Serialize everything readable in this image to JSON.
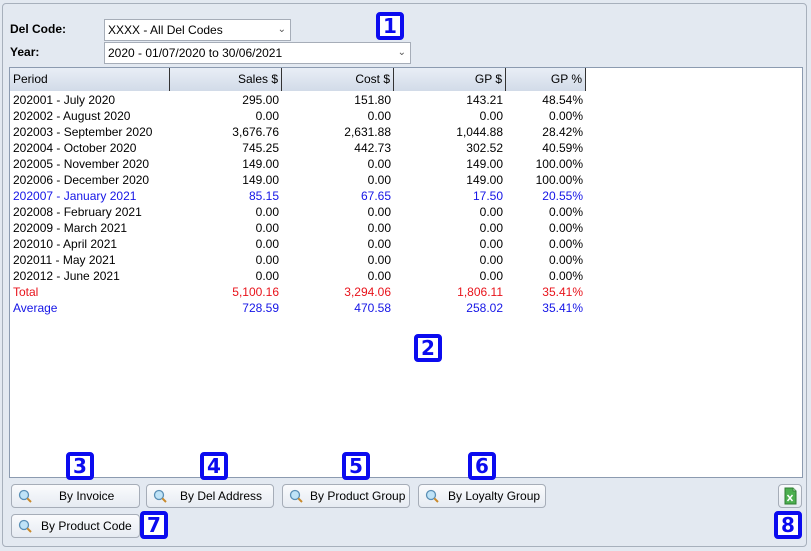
{
  "filters": {
    "del_code_label": "Del Code:",
    "del_code_value": "XXXX - All Del Codes",
    "year_label": "Year:",
    "year_value": "2020 - 01/07/2020 to 30/06/2021"
  },
  "table": {
    "columns": [
      "Period",
      "Sales $",
      "Cost $",
      "GP $",
      "GP %"
    ],
    "rows": [
      {
        "period": "202001 - July 2020",
        "sales": "295.00",
        "cost": "151.80",
        "gp": "143.21",
        "gp_pct": "48.54%",
        "style": "normal"
      },
      {
        "period": "202002 - August 2020",
        "sales": "0.00",
        "cost": "0.00",
        "gp": "0.00",
        "gp_pct": "0.00%",
        "style": "normal"
      },
      {
        "period": "202003 - September 2020",
        "sales": "3,676.76",
        "cost": "2,631.88",
        "gp": "1,044.88",
        "gp_pct": "28.42%",
        "style": "normal"
      },
      {
        "period": "202004 - October 2020",
        "sales": "745.25",
        "cost": "442.73",
        "gp": "302.52",
        "gp_pct": "40.59%",
        "style": "normal"
      },
      {
        "period": "202005 - November 2020",
        "sales": "149.00",
        "cost": "0.00",
        "gp": "149.00",
        "gp_pct": "100.00%",
        "style": "normal"
      },
      {
        "period": "202006 - December 2020",
        "sales": "149.00",
        "cost": "0.00",
        "gp": "149.00",
        "gp_pct": "100.00%",
        "style": "normal"
      },
      {
        "period": "202007 - January 2021",
        "sales": "85.15",
        "cost": "67.65",
        "gp": "17.50",
        "gp_pct": "20.55%",
        "style": "current"
      },
      {
        "period": "202008 - February 2021",
        "sales": "0.00",
        "cost": "0.00",
        "gp": "0.00",
        "gp_pct": "0.00%",
        "style": "normal"
      },
      {
        "period": "202009 - March 2021",
        "sales": "0.00",
        "cost": "0.00",
        "gp": "0.00",
        "gp_pct": "0.00%",
        "style": "normal"
      },
      {
        "period": "202010 - April 2021",
        "sales": "0.00",
        "cost": "0.00",
        "gp": "0.00",
        "gp_pct": "0.00%",
        "style": "normal"
      },
      {
        "period": "202011 - May 2021",
        "sales": "0.00",
        "cost": "0.00",
        "gp": "0.00",
        "gp_pct": "0.00%",
        "style": "normal"
      },
      {
        "period": "202012 - June 2021",
        "sales": "0.00",
        "cost": "0.00",
        "gp": "0.00",
        "gp_pct": "0.00%",
        "style": "normal"
      },
      {
        "period": "Total",
        "sales": "5,100.16",
        "cost": "3,294.06",
        "gp": "1,806.11",
        "gp_pct": "35.41%",
        "style": "total"
      },
      {
        "period": "Average",
        "sales": "728.59",
        "cost": "470.58",
        "gp": "258.02",
        "gp_pct": "35.41%",
        "style": "average"
      }
    ]
  },
  "buttons": {
    "by_invoice": "By Invoice",
    "by_del_address": "By Del Address",
    "by_product_group": "By Product Group",
    "by_loyalty_group": "By Loyalty Group",
    "by_product_code": "By Product Code",
    "export_icon": "excel-export-icon"
  },
  "colors": {
    "highlight_blue": "#1515e6",
    "total_red": "#e8131b",
    "badge_blue": "#0b0bef"
  },
  "badges": [
    "1",
    "2",
    "3",
    "4",
    "5",
    "6",
    "7",
    "8"
  ]
}
